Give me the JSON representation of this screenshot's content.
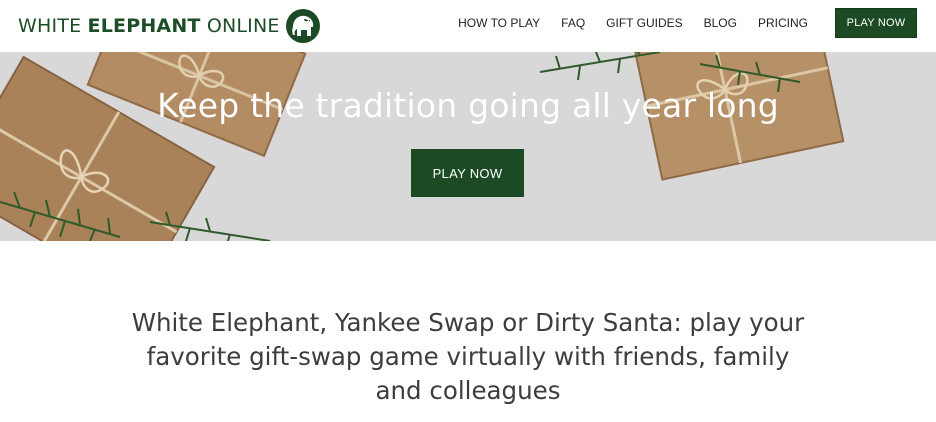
{
  "header": {
    "logo": {
      "text_light_1": "WHITE ",
      "text_bold": "ELEPHANT",
      "text_light_2": " ONLINE",
      "icon": "elephant-icon"
    },
    "nav": [
      {
        "label": "HOW TO PLAY"
      },
      {
        "label": "FAQ"
      },
      {
        "label": "GIFT GUIDES"
      },
      {
        "label": "BLOG"
      },
      {
        "label": "PRICING"
      }
    ],
    "cta_label": "PLAY NOW"
  },
  "hero": {
    "title": "Keep the tradition going all year long",
    "cta_label": "PLAY NOW",
    "image": "wrapped-gifts-with-twine-and-pine"
  },
  "intro": {
    "text": "White Elephant, Yankee Swap or Dirty Santa: play your favorite gift-swap game virtually with friends, family and colleagues"
  },
  "colors": {
    "brand_green": "#1b4a24",
    "hero_background": "#d6d6d6",
    "kraft_paper": "#b08a62",
    "body_text": "#3d3d3d"
  }
}
